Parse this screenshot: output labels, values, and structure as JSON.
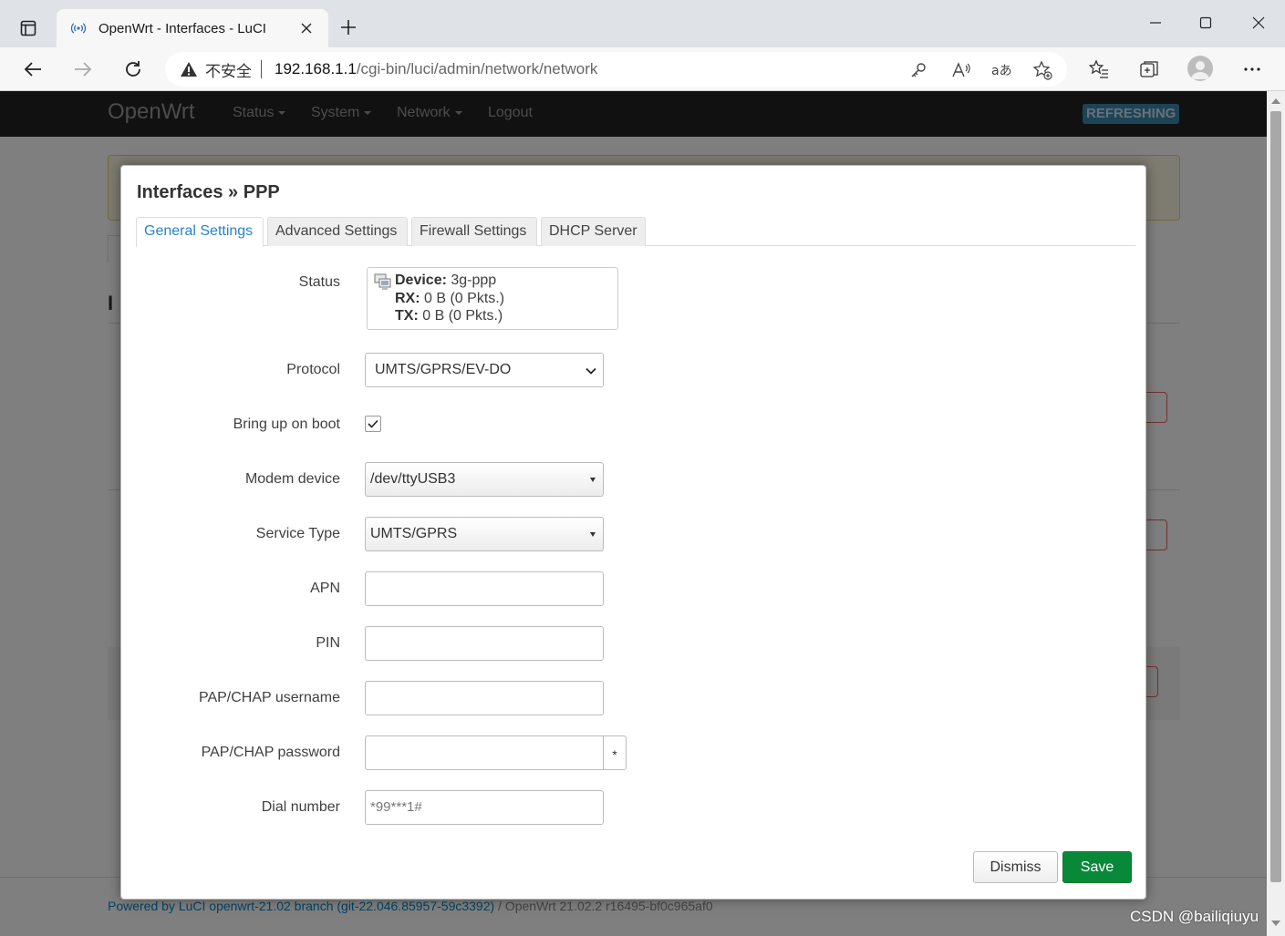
{
  "browser": {
    "tab_title": "OpenWrt - Interfaces - LuCI",
    "insecure_label": "不安全",
    "url_host": "192.168.1.1",
    "url_path": "/cgi-bin/luci/admin/network/network"
  },
  "luci": {
    "brand": "OpenWrt",
    "nav": [
      "Status",
      "System",
      "Network",
      "Logout"
    ],
    "refresh_badge": "REFRESHING",
    "footer_link": "Powered by LuCI openwrt-21.02 branch (git-22.046.85957-59c3392)",
    "footer_version": "/ OpenWrt 21.02.2 r16495-bf0c965af0"
  },
  "modal": {
    "title": "Interfaces » PPP",
    "tabs": [
      "General Settings",
      "Advanced Settings",
      "Firewall Settings",
      "DHCP Server"
    ],
    "active_tab": "General Settings",
    "status": {
      "label": "Status",
      "device_key": "Device:",
      "device_val": "3g-ppp",
      "rx_key": "RX:",
      "rx_val": "0 B (0 Pkts.)",
      "tx_key": "TX:",
      "tx_val": "0 B (0 Pkts.)"
    },
    "fields": {
      "protocol": {
        "label": "Protocol",
        "value": "UMTS/GPRS/EV-DO"
      },
      "bring_up_on_boot": {
        "label": "Bring up on boot",
        "checked": true
      },
      "modem_device": {
        "label": "Modem device",
        "value": "/dev/ttyUSB3"
      },
      "service_type": {
        "label": "Service Type",
        "value": "UMTS/GPRS"
      },
      "apn": {
        "label": "APN",
        "value": ""
      },
      "pin": {
        "label": "PIN",
        "value": ""
      },
      "pap_username": {
        "label": "PAP/CHAP username",
        "value": ""
      },
      "pap_password": {
        "label": "PAP/CHAP password",
        "value": "",
        "reveal": "*"
      },
      "dial_number": {
        "label": "Dial number",
        "placeholder": "*99***1#"
      }
    },
    "buttons": {
      "dismiss": "Dismiss",
      "save": "Save"
    }
  },
  "watermark": "CSDN @bailiqiuyu",
  "colors": {
    "save_green": "#08893a",
    "tab_active_blue": "#2a83c6",
    "header_black": "#222222",
    "badge_blue": "#3a87ad"
  }
}
